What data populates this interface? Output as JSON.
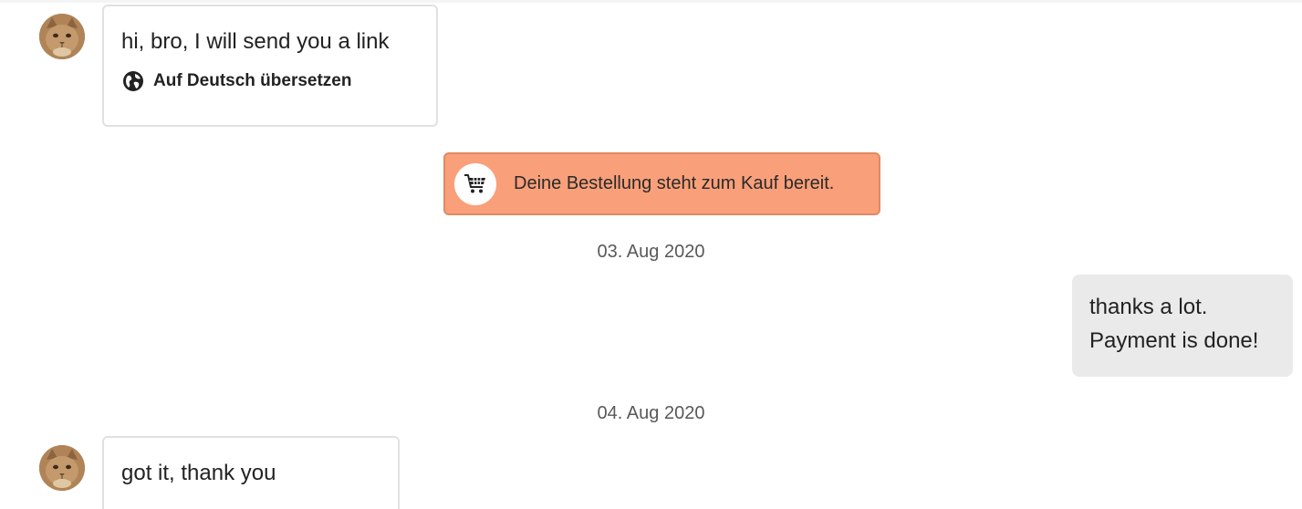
{
  "messages": [
    {
      "direction": "incoming",
      "text": "hi, bro, I will send you a link",
      "translate_label": "Auf Deutsch übersetzen",
      "translate_icon": "globe-icon"
    },
    {
      "direction": "incoming",
      "text": "got it, thank you"
    }
  ],
  "order_notice": {
    "icon": "shopping-cart-icon",
    "text": "Deine Bestellung steht zum Kauf bereit."
  },
  "dates": [
    "03. Aug 2020",
    "04. Aug 2020"
  ],
  "outgoing": {
    "lines": [
      "thanks a lot.",
      "Payment is done!"
    ]
  },
  "colors": {
    "order_banner_bg": "#f9a07a",
    "outgoing_bubble_bg": "#eaeaea",
    "incoming_bubble_border": "#e1e1e1"
  }
}
